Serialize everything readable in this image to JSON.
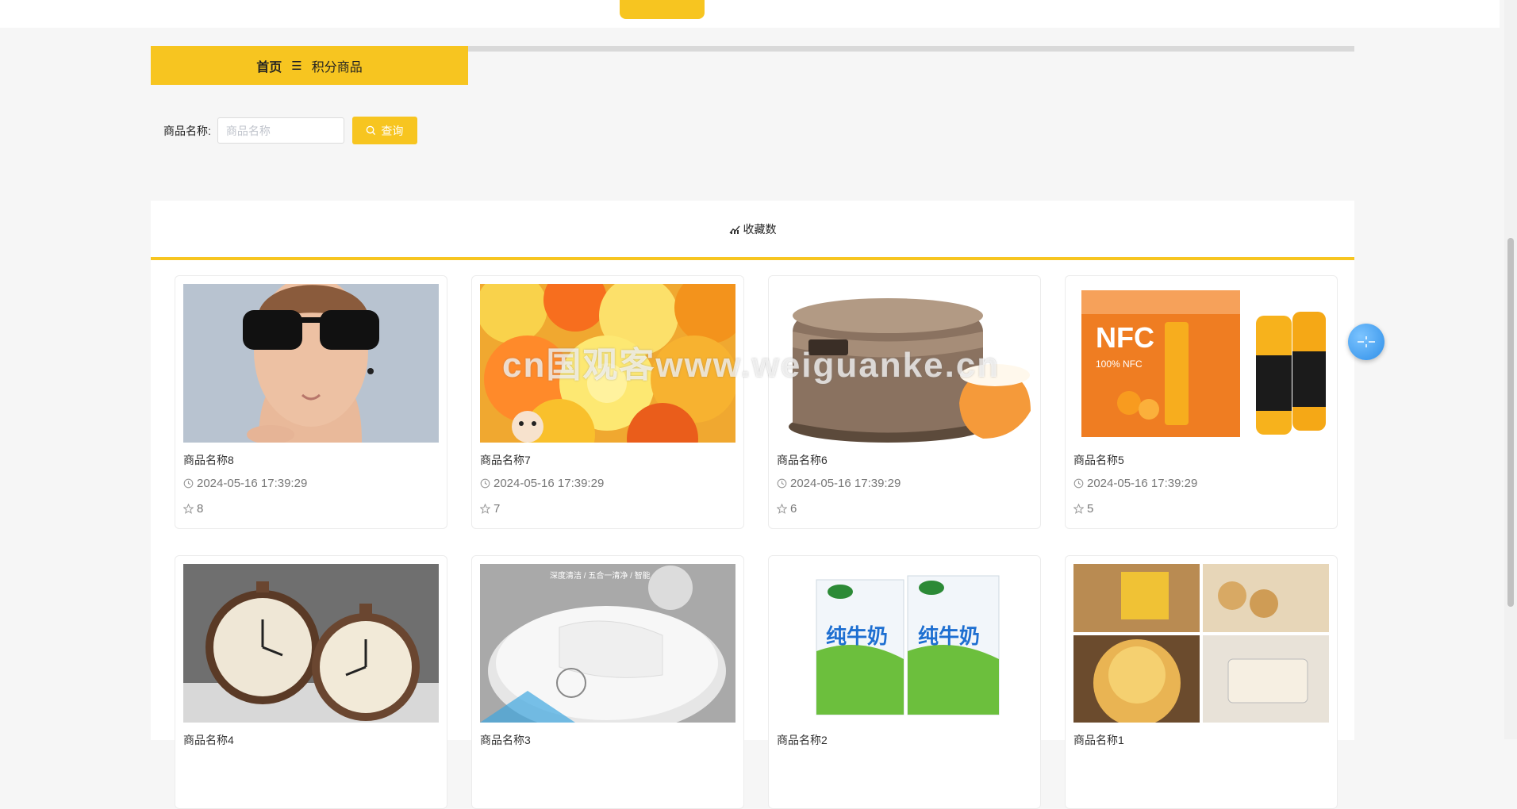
{
  "breadcrumb": {
    "home": "首页",
    "separator": "☰",
    "current": "积分商品"
  },
  "search": {
    "label": "商品名称:",
    "placeholder": "商品名称",
    "button": "查询"
  },
  "panel": {
    "title": "收藏数"
  },
  "products": [
    {
      "name": "商品名称8",
      "time": "2024-05-16 17:39:29",
      "count": "8",
      "image": "sunglasses-model"
    },
    {
      "name": "商品名称7",
      "time": "2024-05-16 17:39:29",
      "count": "7",
      "image": "jelly-cups"
    },
    {
      "name": "商品名称6",
      "time": "2024-05-16 17:39:29",
      "count": "6",
      "image": "rice-cooker"
    },
    {
      "name": "商品名称5",
      "time": "2024-05-16 17:39:29",
      "count": "5",
      "image": "nfc-orange-juice"
    },
    {
      "name": "商品名称4",
      "time": "",
      "count": "",
      "image": "vintage-clocks"
    },
    {
      "name": "商品名称3",
      "time": "",
      "count": "",
      "image": "robot-vacuum"
    },
    {
      "name": "商品名称2",
      "time": "",
      "count": "",
      "image": "milk-cartons"
    },
    {
      "name": "商品名称1",
      "time": "",
      "count": "",
      "image": "cookies"
    }
  ],
  "image_labels": {
    "juice_box_brand": "NFC",
    "juice_box_sub": "100% NFC",
    "milk_text": "纯牛奶",
    "vacuum_caption": "深度清洁 / 五合一清净 / 智能"
  },
  "watermark": "cn国观客www.weiguanke.cn",
  "colors": {
    "accent": "#f7c520",
    "float_button": "#3b95ec"
  }
}
